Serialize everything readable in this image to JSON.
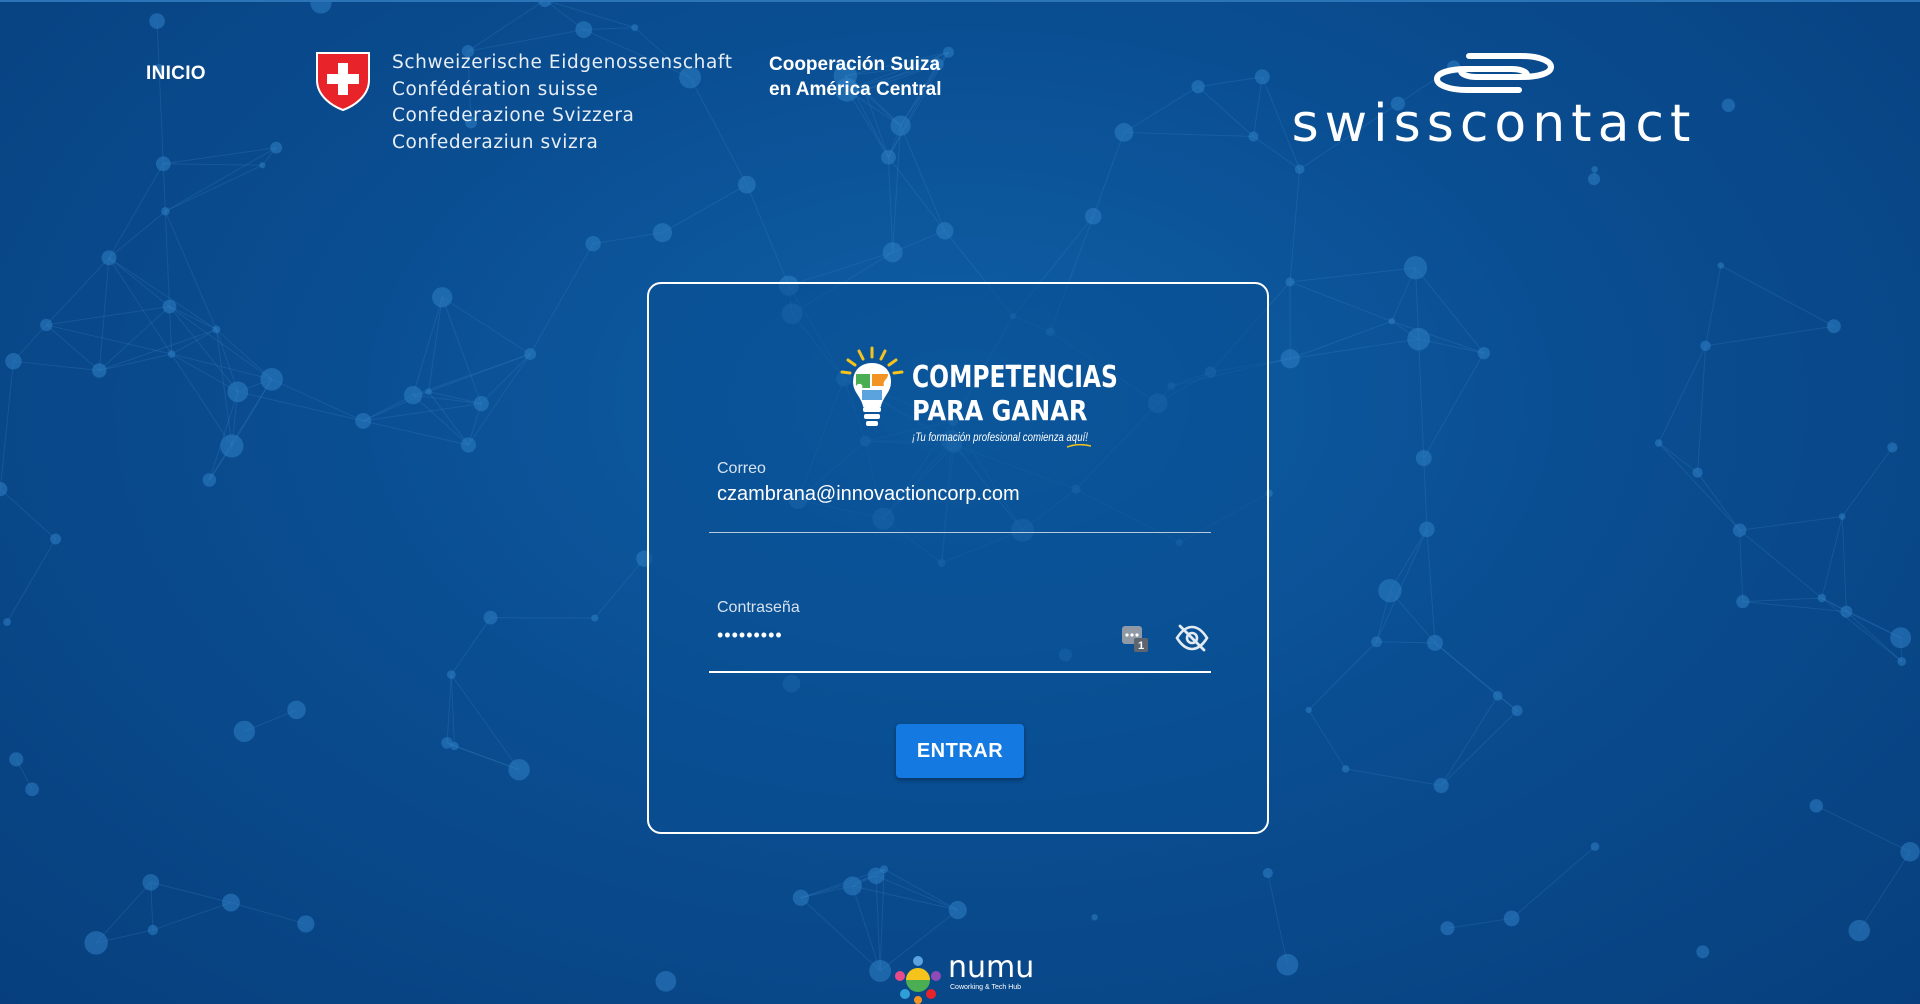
{
  "header": {
    "nav_inicio": "INICIO",
    "swiss_confederation_lines": [
      "Schweizerische Eidgenossenschaft",
      "Confédération suisse",
      "Confederazione Svizzera",
      "Confederaziun svizra"
    ],
    "cooperacion_line1": "Cooperación Suiza",
    "cooperacion_line2": "en América Central",
    "swisscontact_name": "swisscontact"
  },
  "login": {
    "brand_title_1": "COMPETENCIAS",
    "brand_title_2": "PARA GANAR",
    "brand_tagline": "¡Tu formación profesional comienza aquí!",
    "email_label": "Correo",
    "email_value": "czambrana@innovactioncorp.com",
    "password_label": "Contraseña",
    "password_value": "•••••••••",
    "submit_label": "ENTRAR",
    "pw_manager_badge": "1"
  },
  "footer": {
    "numu_name": "numu",
    "numu_sub": "Coworking & Tech Hub"
  },
  "colors": {
    "background": "#0a4e92",
    "button": "#1479e0",
    "swiss_red": "#e8232a",
    "brand_yellow": "#f6c31c",
    "brand_green": "#4cae52",
    "brand_orange": "#f29322"
  },
  "icons": {
    "password_manager": "password-manager-icon",
    "visibility": "eye-off-icon",
    "swiss_shield": "swiss-cross-shield-icon"
  }
}
